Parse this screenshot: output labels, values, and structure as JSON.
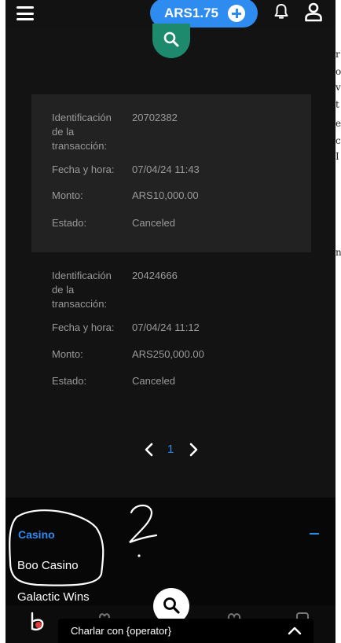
{
  "header": {
    "balance": "ARS1.75"
  },
  "transactions": [
    {
      "id_label": "Identificación de la transacción:",
      "id_value": "20702382",
      "datetime_label": "Fecha y hora:",
      "datetime_value": "07/04/24 11:43",
      "amount_label": "Monto:",
      "amount_value": "ARS10,000.00",
      "status_label": "Estado:",
      "status_value": "Canceled"
    },
    {
      "id_label": "Identificación de la transacción:",
      "id_value": "20424666",
      "datetime_label": "Fecha y hora:",
      "datetime_value": "07/04/24 11:12",
      "amount_label": "Monto:",
      "amount_value": "ARS250,000.00",
      "status_label": "Estado:",
      "status_value": "Canceled"
    }
  ],
  "pagination": {
    "current_page": "1"
  },
  "footer": {
    "section_title": "Casino",
    "links": [
      "Boo Casino",
      "Galactic Wins"
    ]
  },
  "chat": {
    "label": "Charlar con {operator}"
  },
  "colors": {
    "accent": "#2e8bef",
    "search_green": "#1d8a6e",
    "background": "#131313"
  },
  "icons": [
    "menu-icon",
    "plus-icon",
    "bell-icon",
    "user-icon",
    "search-icon",
    "chevron-left-icon",
    "chevron-right-icon",
    "chevron-up-icon",
    "brand-logo-icon"
  ]
}
